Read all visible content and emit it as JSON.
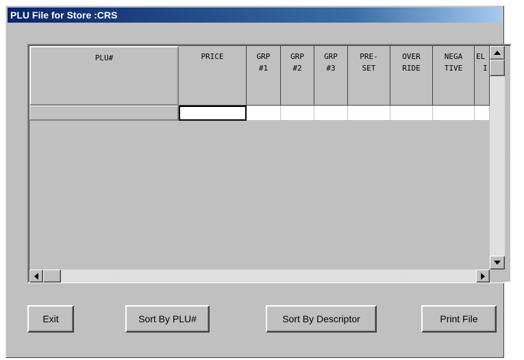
{
  "window": {
    "title": "PLU File for Store :CRS"
  },
  "grid": {
    "columns": [
      {
        "id": "plu",
        "line1": "PLU#",
        "line2": ""
      },
      {
        "id": "price",
        "line1": "PRICE",
        "line2": ""
      },
      {
        "id": "grp1",
        "line1": "GRP",
        "line2": "#1"
      },
      {
        "id": "grp2",
        "line1": "GRP",
        "line2": "#2"
      },
      {
        "id": "grp3",
        "line1": "GRP",
        "line2": "#3"
      },
      {
        "id": "preset",
        "line1": "PRE-",
        "line2": "SET"
      },
      {
        "id": "override",
        "line1": "OVER",
        "line2": "RIDE"
      },
      {
        "id": "negative",
        "line1": "NEGA",
        "line2": "TIVE"
      },
      {
        "id": "el",
        "line1": "EL",
        "line2": "I"
      }
    ]
  },
  "buttons": {
    "exit": "Exit",
    "sort_plu": "Sort By PLU#",
    "sort_descriptor": "Sort By Descriptor",
    "print_file": "Print File"
  },
  "icons": [
    "scroll-up-icon",
    "scroll-down-icon",
    "scroll-left-icon",
    "scroll-right-icon"
  ]
}
